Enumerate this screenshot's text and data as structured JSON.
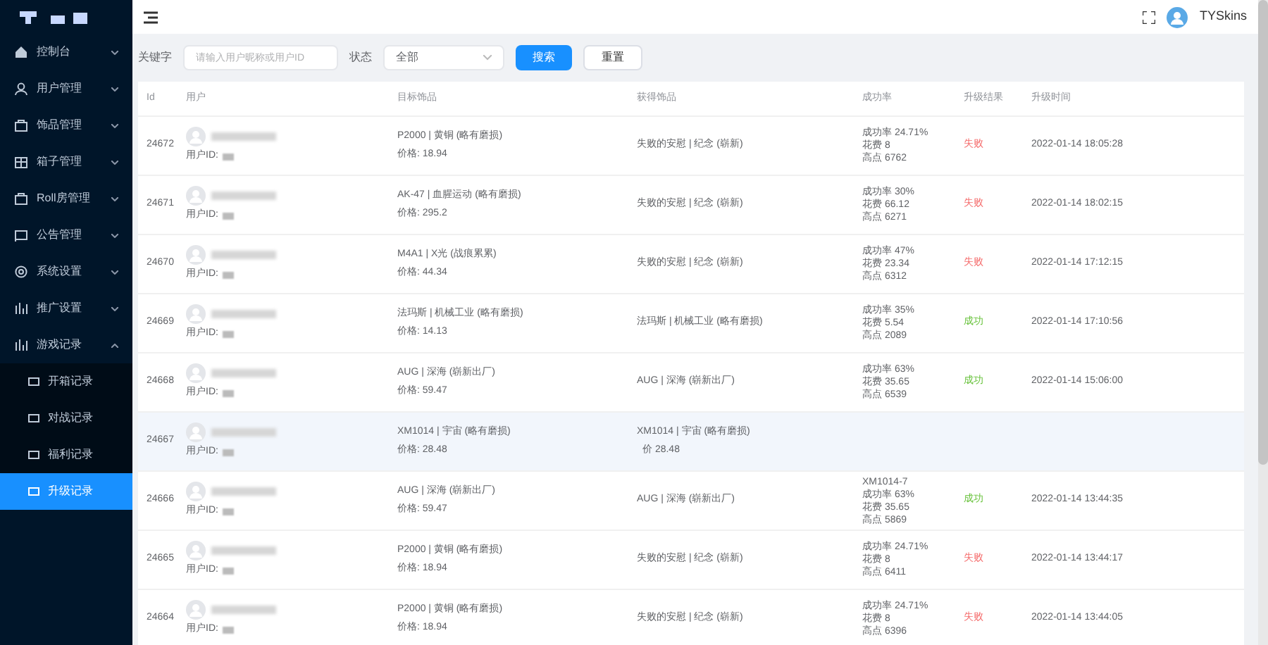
{
  "header": {
    "username": "TYSkins"
  },
  "sidebar": {
    "items": [
      {
        "label": "控制台",
        "kind": "home",
        "expanded": false
      },
      {
        "label": "用户管理",
        "kind": "user",
        "expanded": false
      },
      {
        "label": "饰品管理",
        "kind": "bag",
        "expanded": false
      },
      {
        "label": "箱子管理",
        "kind": "box",
        "expanded": false
      },
      {
        "label": "Roll房管理",
        "kind": "bag",
        "expanded": false
      },
      {
        "label": "公告管理",
        "kind": "card",
        "expanded": false
      },
      {
        "label": "系统设置",
        "kind": "gear",
        "expanded": false
      },
      {
        "label": "推广设置",
        "kind": "chart",
        "expanded": false
      },
      {
        "label": "游戏记录",
        "kind": "chart",
        "expanded": true,
        "children": [
          {
            "label": "开箱记录",
            "selected": false
          },
          {
            "label": "对战记录",
            "selected": false
          },
          {
            "label": "福利记录",
            "selected": false
          },
          {
            "label": "升级记录",
            "selected": true
          }
        ]
      }
    ]
  },
  "filters": {
    "keyword_label": "关键字",
    "keyword_placeholder": "请输入用户昵称或用户ID",
    "status_label": "状态",
    "status_value": "全部",
    "search_button": "搜索",
    "reset_button": "重置"
  },
  "table": {
    "columns": [
      "Id",
      "用户",
      "目标饰品",
      "获得饰品",
      "成功率",
      "升级结果",
      "升级时间"
    ],
    "rows": [
      {
        "id": "24672",
        "user_id_label": "用户ID:",
        "target": "P2000 | 黄铜 (略有磨损)",
        "price": "价格: 18.94",
        "obtained": "失败的安慰 | 纪念 (崭新)",
        "rate": "成功率 24.71%",
        "cost": "花费 8",
        "roll": "高点 6762",
        "result": "失败",
        "success": false,
        "time": "2022-01-14 18:05:28",
        "hover": false
      },
      {
        "id": "24671",
        "user_id_label": "用户ID:",
        "target": "AK-47 | 血腥运动 (略有磨损)",
        "price": "价格: 295.2",
        "obtained": "失败的安慰 | 纪念 (崭新)",
        "rate": "成功率 30%",
        "cost": "花费 66.12",
        "roll": "高点 6271",
        "result": "失败",
        "success": false,
        "time": "2022-01-14 18:02:15",
        "hover": false
      },
      {
        "id": "24670",
        "user_id_label": "用户ID:",
        "target": "M4A1 | X光 (战痕累累)",
        "price": "价格: 44.34",
        "obtained": "失败的安慰 | 纪念 (崭新)",
        "rate": "成功率 47%",
        "cost": "花费 23.34",
        "roll": "高点 6312",
        "result": "失败",
        "success": false,
        "time": "2022-01-14 17:12:15",
        "hover": false
      },
      {
        "id": "24669",
        "user_id_label": "用户ID:",
        "target": "法玛斯 | 机械工业 (略有磨损)",
        "price": "价格: 14.13",
        "obtained": "法玛斯 | 机械工业 (略有磨损)",
        "rate": "成功率 35%",
        "cost": "花费 5.54",
        "roll": "高点 2089",
        "result": "成功",
        "success": true,
        "time": "2022-01-14 17:10:56",
        "hover": false
      },
      {
        "id": "24668",
        "user_id_label": "用户ID:",
        "target": "AUG | 深海 (崭新出厂)",
        "price": "价格: 59.47",
        "obtained": "AUG | 深海 (崭新出厂)",
        "rate": "成功率 63%",
        "cost": "花费 35.65",
        "roll": "高点 6539",
        "result": "成功",
        "success": true,
        "time": "2022-01-14 15:06:00",
        "hover": false
      },
      {
        "id": "24667",
        "user_id_label": "用户ID:",
        "target": "XM1014 | 宇宙 (略有磨损)",
        "price": "价格: 28.48",
        "obtained": "XM1014 | 宇宙 (略有磨损)",
        "obtained_price": "价 28.48",
        "hover": true
      },
      {
        "id": "24666",
        "user_id_label": "用户ID:",
        "target": "AUG | 深海 (崭新出厂)",
        "price": "价格: 59.47",
        "obtained": "AUG | 深海 (崭新出厂)",
        "tooltip": "XM1014-7",
        "rate": "成功率 63%",
        "cost": "花费 35.65",
        "roll": "高点 5869",
        "result": "成功",
        "success": true,
        "time": "2022-01-14 13:44:35",
        "hover": false
      },
      {
        "id": "24665",
        "user_id_label": "用户ID:",
        "target": "P2000 | 黄铜 (略有磨损)",
        "price": "价格: 18.94",
        "obtained": "失败的安慰 | 纪念 (崭新)",
        "rate": "成功率 24.71%",
        "cost": "花费 8",
        "roll": "高点 6411",
        "result": "失败",
        "success": false,
        "time": "2022-01-14 13:44:17",
        "hover": false
      },
      {
        "id": "24664",
        "user_id_label": "用户ID:",
        "target": "P2000 | 黄铜 (略有磨损)",
        "price": "价格: 18.94",
        "obtained": "失败的安慰 | 纪念 (崭新)",
        "rate": "成功率 24.71%",
        "cost": "花费 8",
        "roll": "高点 6396",
        "result": "失败",
        "success": false,
        "time": "2022-01-14 13:44:05",
        "hover": false
      }
    ]
  }
}
